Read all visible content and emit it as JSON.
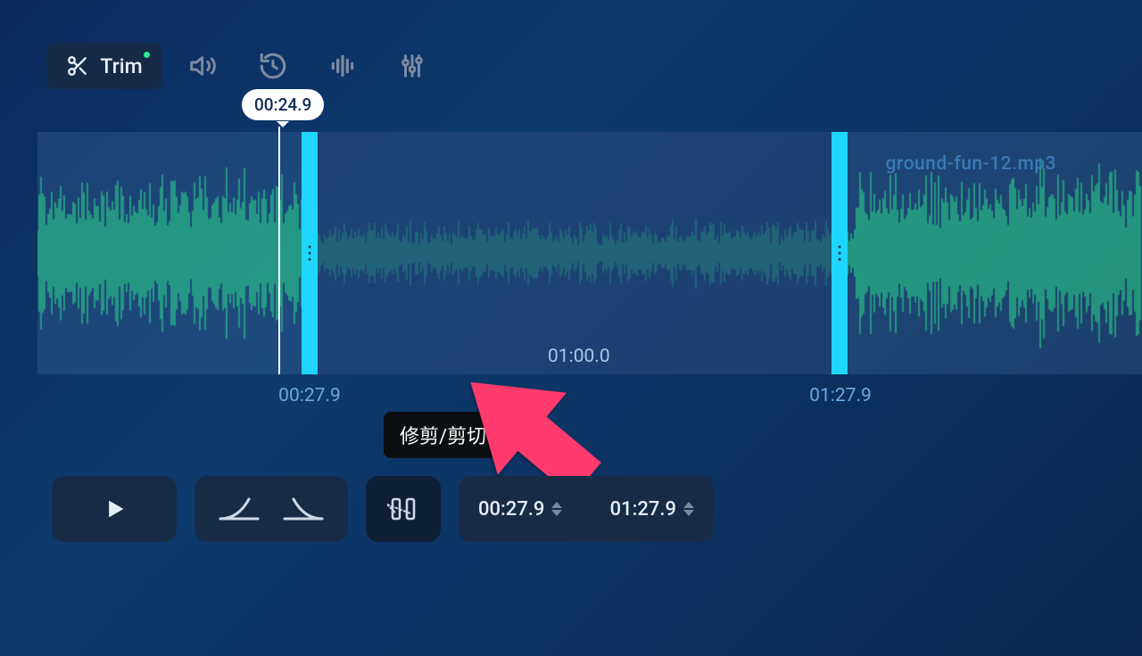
{
  "colors": {
    "accent_handle": "#1fd6ff",
    "waveform": "#2de98d",
    "arrow": "#ff3a6e"
  },
  "toolbar": {
    "trim_label": "Trim"
  },
  "timeline": {
    "playhead_time": "00:24.9",
    "midpoint_label": "01:00.0",
    "filename": "ground-fun-12.mp3",
    "start_label": "00:27.9",
    "end_label": "01:27.9"
  },
  "tooltip": {
    "cut_label": "修剪/剪切"
  },
  "controls": {
    "start_time": "00:27.9",
    "end_time": "01:27.9"
  }
}
